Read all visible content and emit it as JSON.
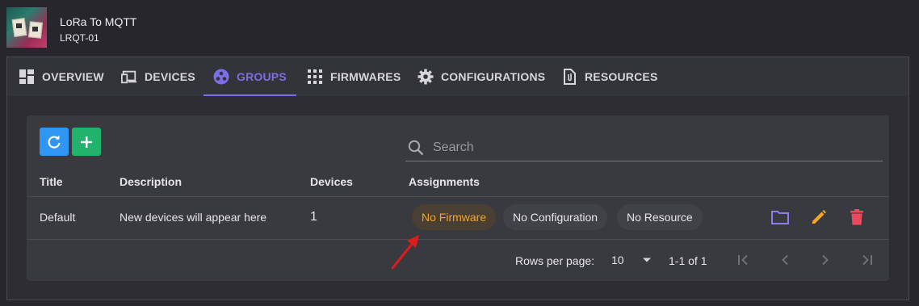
{
  "app": {
    "title": "LoRa To MQTT",
    "subtitle": "LRQT-01"
  },
  "tabs": [
    {
      "label": "OVERVIEW",
      "icon": "dashboard-icon"
    },
    {
      "label": "DEVICES",
      "icon": "devices-icon"
    },
    {
      "label": "GROUPS",
      "icon": "groups-icon",
      "active": true
    },
    {
      "label": "FIRMWARES",
      "icon": "apps-grid-icon"
    },
    {
      "label": "CONFIGURATIONS",
      "icon": "gear-icon"
    },
    {
      "label": "RESOURCES",
      "icon": "file-attachment-icon"
    }
  ],
  "toolbar": {
    "refresh_icon": "refresh-icon",
    "add_icon": "plus-icon"
  },
  "search": {
    "placeholder": "Search"
  },
  "table": {
    "headers": [
      "Title",
      "Description",
      "Devices",
      "Assignments"
    ],
    "rows": [
      {
        "title": "Default",
        "description": "New devices will appear here",
        "devices": "1",
        "assignments": {
          "firmware": "No Firmware",
          "configuration": "No Configuration",
          "resource": "No Resource"
        },
        "actions": [
          "folder-icon",
          "pencil-icon",
          "trash-icon"
        ]
      }
    ]
  },
  "pagination": {
    "rows_per_page_label": "Rows per page:",
    "rows_per_page": "10",
    "range": "1-1 of 1"
  },
  "colors": {
    "background": "#26262c",
    "panel": "#2d2d33",
    "card": "#393940",
    "accent": "#7b6ee6",
    "refresh_button": "#2f96f3",
    "add_button": "#21b36b",
    "firmware_chip_text": "#f5a623",
    "edit_icon": "#f5a623",
    "delete_icon": "#e94a5f",
    "folder_icon": "#8b7cf0",
    "annotation_arrow": "#e01b1b"
  }
}
